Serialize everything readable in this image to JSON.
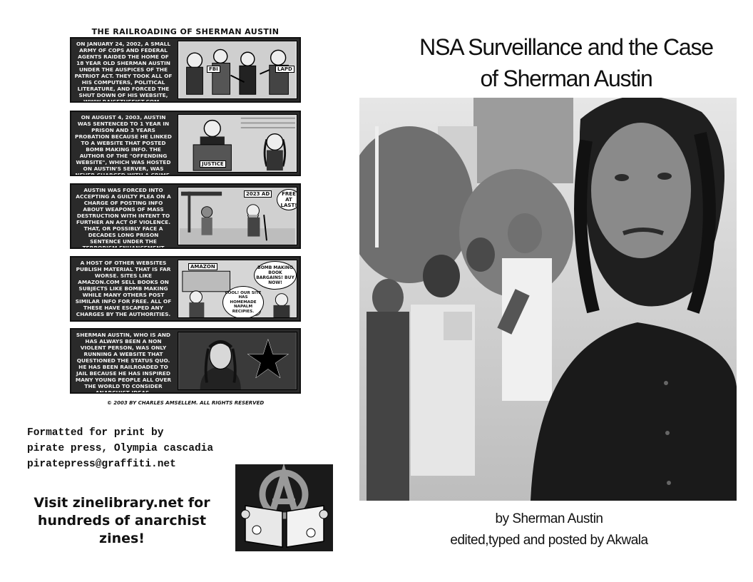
{
  "comic": {
    "title": "THE RAILROADING OF SHERMAN AUSTIN",
    "panels": [
      {
        "text": "ON JANUARY 24, 2002, A SMALL ARMY OF COPS AND FEDERAL AGENTS RAIDED THE HOME OF 18 YEAR OLD SHERMAN AUSTIN UNDER THE AUSPICES OF THE PATRIOT ACT. THEY TOOK ALL OF HIS COMPUTERS, POLITICAL LITERATURE, AND FORCED THE SHUT DOWN OF HIS WEBSITE, WWW.RAISETHEFIST.COM..",
        "labels": [
          "FBI",
          "LAPD"
        ]
      },
      {
        "text": "ON AUGUST 4, 2003, AUSTIN WAS SENTENCED TO 1 YEAR IN PRISON AND 3 YEARS PROBATION BECAUSE HE LINKED TO A WEBSITE THAT POSTED BOMB MAKING INFO. THE AUTHOR OF THE \"OFFENDING WEBSITE\", WHICH WAS HOSTED ON AUSTIN'S SERVER, WAS NEVER CHARGED WITH A CRIME.",
        "labels": [
          "JUSTICE"
        ]
      },
      {
        "text": "AUSTIN WAS FORCED INTO ACCEPTING A GUILTY PLEA ON A CHARGE OF POSTING INFO ABOUT WEAPONS OF MASS DESTRUCTION WITH INTENT TO FURTHER AN ACT OF VIOLENCE. THAT, OR POSSIBLY FACE A DECADES LONG PRISON SENTENCE UNDER THE TERRORISM ENHANCEMENT CLAUSES ENACTED BEFORE THE PATRIOT ACT.",
        "labels": [
          "2023 AD",
          "FREE AT LAST!"
        ]
      },
      {
        "text": "A HOST OF OTHER WEBSITES PUBLISH MATERIAL THAT IS FAR WORSE. SITES LIKE AMAZON.COM SELL BOOKS ON SUBJECTS LIKE BOMB MAKING WHILE MANY OTHERS POST SIMILAR INFO FOR FREE. ALL OF THESE HAVE ESCAPED ANY CHARGES BY THE AUTHORITIES.",
        "labels": [
          "AMAZON",
          "BOMB MAKING BOOK BARGAINS! BUY NOW!",
          "COOL! OUR SITE HAS HOMEMADE NAPALM RECIPIES."
        ]
      },
      {
        "text": "SHERMAN AUSTIN, WHO IS AND HAS ALWAYS BEEN A NON VIOLENT PERSON, WAS ONLY RUNNING A WEBSITE THAT QUESTIONED THE STATUS QUO. HE HAS BEEN RAILROADED TO JAIL BECAUSE HE HAS INSPIRED MANY YOUNG PEOPLE ALL OVER THE WORLD TO CONSIDER ANARCHIST IDEAS.",
        "labels": []
      }
    ],
    "copyright": "© 2003 BY CHARLES AMSELLEM. ALL RIGHTS RESERVED"
  },
  "credits": {
    "lines": [
      "Formatted for print by",
      "pirate press, Olympia cascadia",
      "piratepress@graffiti.net"
    ],
    "visit_lines": [
      "Visit zinelibrary.net for",
      "hundreds of anarchist",
      "zines!"
    ]
  },
  "cover": {
    "title_lines": [
      "NSA Surveillance and the Case",
      "of Sherman Austin"
    ],
    "byline_lines": [
      "by Sherman Austin",
      "edited,typed and posted by Akwala"
    ]
  },
  "icons": {
    "logo": "anarchy-reader-logo-icon",
    "star": "black-star-icon",
    "photo": "sherman-austin-photo"
  },
  "colors": {
    "panel_bg": "#2a2a2a",
    "panel_text": "#f2f2f2",
    "art_bg": "#d9d9d9"
  }
}
